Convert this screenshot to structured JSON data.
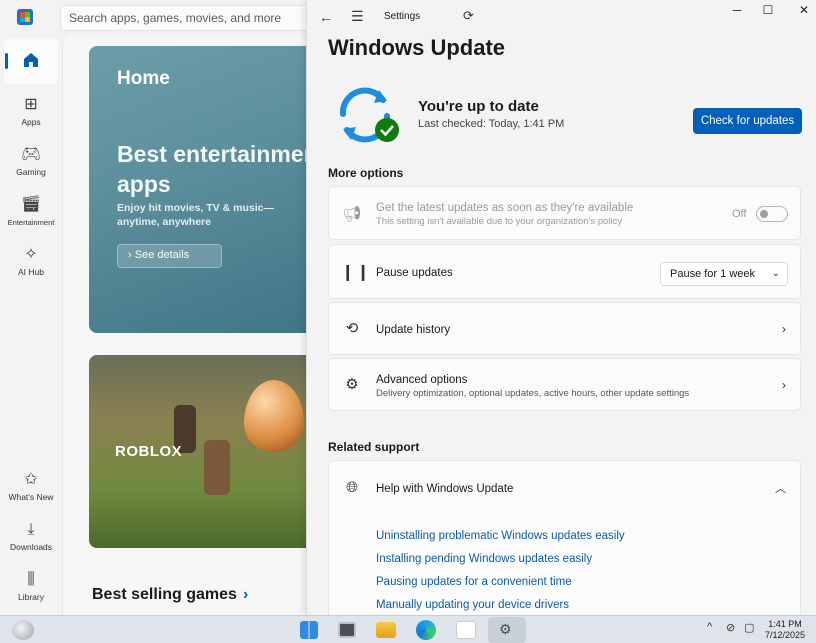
{
  "store": {
    "search_placeholder": "Search apps, games, movies, and more",
    "nav": [
      {
        "label": "",
        "icon": "home-icon"
      },
      {
        "label": "Apps",
        "icon": "apps-icon"
      },
      {
        "label": "Gaming",
        "icon": "gaming-icon"
      },
      {
        "label": "Entertainment",
        "icon": "entertainment-icon"
      },
      {
        "label": "AI Hub",
        "icon": "ai-hub-icon"
      }
    ],
    "nav_bottom": [
      {
        "label": "What's New",
        "icon": "whats-new-icon"
      },
      {
        "label": "Downloads",
        "icon": "downloads-icon"
      },
      {
        "label": "Library",
        "icon": "library-icon"
      }
    ],
    "hero": {
      "title": "Home",
      "headline": "Best entertainment apps",
      "subtitle": "Enjoy hit movies, TV & music—anytime, anywhere",
      "button": "See details"
    },
    "promo_label": "ROBLOX",
    "section_title": "Best selling games",
    "section_chevron": "›"
  },
  "settings": {
    "window_title": "Settings",
    "page_title": "Windows Update",
    "status_title": "You're up to date",
    "status_sub": "Last checked: Today, 1:41 PM",
    "check_button": "Check for updates",
    "more_options_label": "More options",
    "latest_updates": {
      "title": "Get the latest updates as soon as they're available",
      "desc": "This setting isn't available due to your organization's policy",
      "toggle_state": "Off"
    },
    "pause_updates": {
      "title": "Pause updates",
      "dropdown_value": "Pause for 1 week"
    },
    "update_history": {
      "title": "Update history"
    },
    "advanced_options": {
      "title": "Advanced options",
      "desc": "Delivery optimization, optional updates, active hours, other update settings"
    },
    "related_support_label": "Related support",
    "help": {
      "title": "Help with Windows Update"
    },
    "help_links": [
      "Uninstalling problematic Windows updates easily",
      "Installing pending Windows updates easily",
      "Pausing updates for a convenient time",
      "Manually updating your device drivers"
    ]
  },
  "taskbar": {
    "time": "1:41 PM",
    "date": "7/12/2025",
    "apps": [
      "weather-icon",
      "start-icon",
      "task-view-icon",
      "file-explorer-icon",
      "edge-icon",
      "store-icon",
      "settings-icon"
    ]
  },
  "colors": {
    "accent": "#005fb8",
    "link": "#0b5cad",
    "success": "#0f7b0f"
  }
}
